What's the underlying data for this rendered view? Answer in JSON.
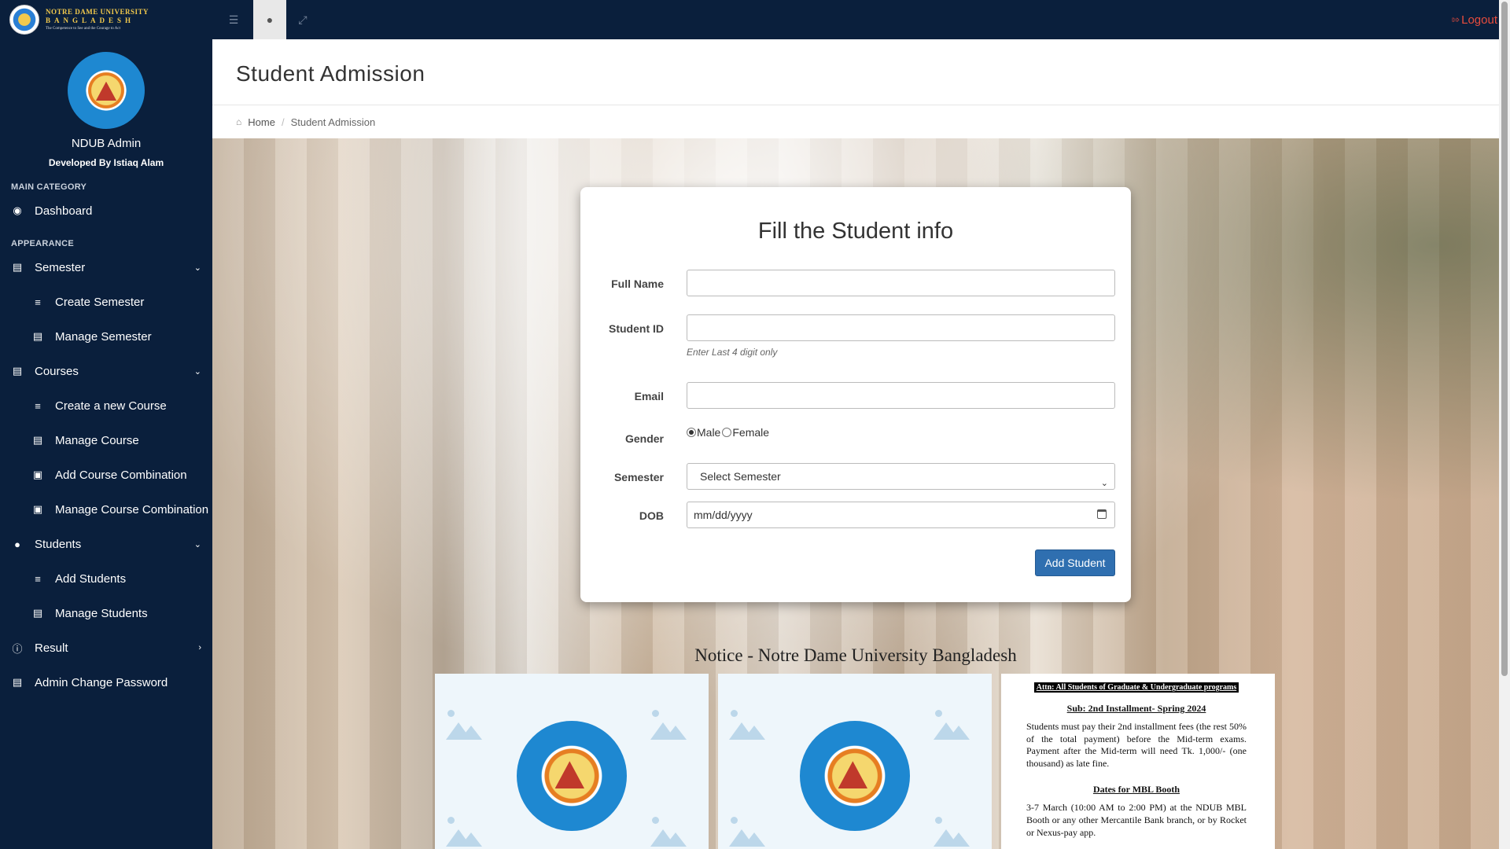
{
  "brand": {
    "line1": "NOTRE DAME UNIVERSITY",
    "line2": "BANGLADESH",
    "line3": "The Competence to See and the Courage to Act"
  },
  "topbar": {
    "logout_label": "Logout"
  },
  "sidebar": {
    "profile_name": "NDUB Admin",
    "developer": "Developed By Istiaq Alam",
    "section_main": "MAIN CATEGORY",
    "section_appearance": "APPEARANCE",
    "items": {
      "dashboard": "Dashboard",
      "semester": "Semester",
      "create_semester": "Create Semester",
      "manage_semester": "Manage Semester",
      "courses": "Courses",
      "create_course": "Create a new Course",
      "manage_course": "Manage Course",
      "add_combination": "Add Course Combination",
      "manage_combination": "Manage Course Combination",
      "students": "Students",
      "add_students": "Add Students",
      "manage_students": "Manage Students",
      "result": "Result",
      "admin_password": "Admin Change Password"
    }
  },
  "page": {
    "title": "Student Admission",
    "breadcrumb_home": "Home",
    "breadcrumb_current": "Student Admission"
  },
  "form": {
    "heading": "Fill the Student info",
    "full_name_label": "Full Name",
    "full_name_value": "",
    "student_id_label": "Student ID",
    "student_id_value": "",
    "student_id_help": "Enter Last 4 digit only",
    "email_label": "Email",
    "email_value": "",
    "gender_label": "Gender",
    "gender_male": "Male",
    "gender_female": "Female",
    "gender_selected": "Male",
    "semester_label": "Semester",
    "semester_selected": "Select Semester",
    "dob_label": "DOB",
    "dob_placeholder": "mm/dd/yyyy",
    "submit_label": "Add Student"
  },
  "notice": {
    "title": "Notice - Notre Dame University Bangladesh",
    "doc": {
      "attn": "Attn: All Students of Graduate & Undergraduate programs",
      "subject": "Sub: 2nd Installment- Spring 2024",
      "body": "Students must pay their 2nd installment fees (the rest 50% of the total payment) before the Mid-term exams. Payment after the Mid-term will need Tk. 1,000/- (one thousand) as late fine.",
      "dates_heading": "Dates for MBL Booth",
      "dates_body": "3-7 March (10:00 AM to 2:00 PM) at the NDUB MBL Booth or any other Mercantile Bank branch, or by Rocket or Nexus-pay app."
    }
  },
  "colors": {
    "sidebar_bg": "#0a1f3c",
    "accent_button": "#2f6fb0",
    "logout": "#e74c3c"
  }
}
